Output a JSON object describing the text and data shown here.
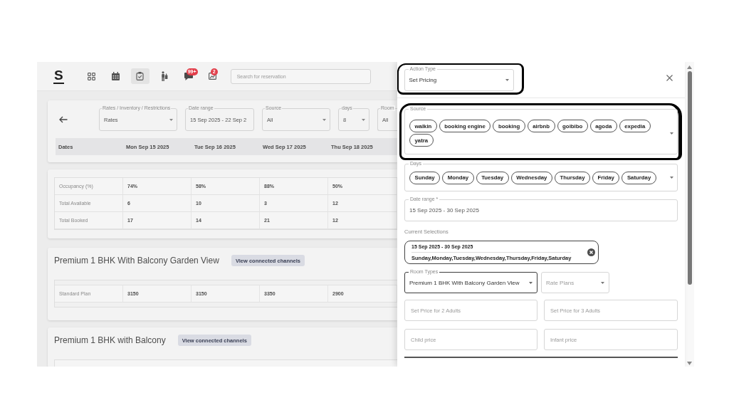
{
  "nav": {
    "logo": "S",
    "items": [
      {
        "selected": false
      },
      {
        "selected": false
      },
      {
        "selected": true
      },
      {
        "selected": false
      },
      {
        "selected": false,
        "badge": "99+"
      },
      {
        "selected": false,
        "badge": "2"
      }
    ],
    "search": {
      "placeholder": "Search for reservation"
    }
  },
  "filters": [
    {
      "kind": "select",
      "label": "Rates / Inventory / Restrictions",
      "value": "Rates"
    },
    {
      "kind": "text",
      "label": "Date range",
      "value": "15 Sep 2025 - 22 Sep 2"
    },
    {
      "kind": "select",
      "label": "Source",
      "value": "All"
    },
    {
      "kind": "select",
      "label": "days",
      "value": "8"
    },
    {
      "kind": "select",
      "label": "Room",
      "value": "All",
      "cut_off": true
    }
  ],
  "dates_table": {
    "columns": [
      "Dates",
      "Mon Sep 15 2025",
      "Tue Sep 16 2025",
      "Wed Sep 17 2025",
      "Thu Sep 18 2025"
    ]
  },
  "stats": [
    {
      "label": "Occupancy (%)",
      "values": [
        "74%",
        "58%",
        "88%",
        "50%"
      ]
    },
    {
      "label": "Total Available",
      "values": [
        "6",
        "10",
        "3",
        "12"
      ]
    },
    {
      "label": "Total Booked",
      "values": [
        "17",
        "14",
        "21",
        "12"
      ]
    }
  ],
  "rooms": [
    {
      "name": "Premium 1 BHK With Balcony Garden View",
      "button": "View connected channels",
      "plans": [
        {
          "name": "Standard Plan",
          "values": [
            "3150",
            "3150",
            "3350",
            "2900"
          ]
        }
      ]
    },
    {
      "name": "Premium 1 BHK with Balcony",
      "button": "View connected channels"
    }
  ],
  "drawer": {
    "action_type": {
      "label": "Action Type",
      "value": "Set Pricing",
      "highlighted": true
    },
    "source": {
      "label": "Source",
      "chips": [
        "walkin",
        "booking engine",
        "booking",
        "airbnb",
        "goibibo",
        "agoda",
        "expedia",
        "yatra"
      ],
      "highlighted": true
    },
    "days": {
      "label": "Days",
      "chips": [
        "Sunday",
        "Monday",
        "Tuesday",
        "Wednesday",
        "Thursday",
        "Friday",
        "Saturday"
      ]
    },
    "date_range": {
      "label": "Date range *",
      "value": "15 Sep 2025 - 30 Sep 2025"
    },
    "current_selections": {
      "title": "Current Selections",
      "items": [
        {
          "dates": "15 Sep 2025 - 30 Sep 2025",
          "days": "Sunday,Monday,Tuesday,Wednesday,Thursday,Friday,Saturday"
        }
      ]
    },
    "room_types": {
      "label": "Room Types",
      "value": "Premium 1 BHK With Balcony Garden View",
      "focused": true
    },
    "rate_plans": {
      "placeholder": "Rate Plans"
    },
    "prices": [
      {
        "placeholder": "Set Price for 2 Adults"
      },
      {
        "placeholder": "Set Price for 3 Adults"
      },
      {
        "placeholder": "Child price"
      },
      {
        "placeholder": "Infant price"
      }
    ]
  }
}
